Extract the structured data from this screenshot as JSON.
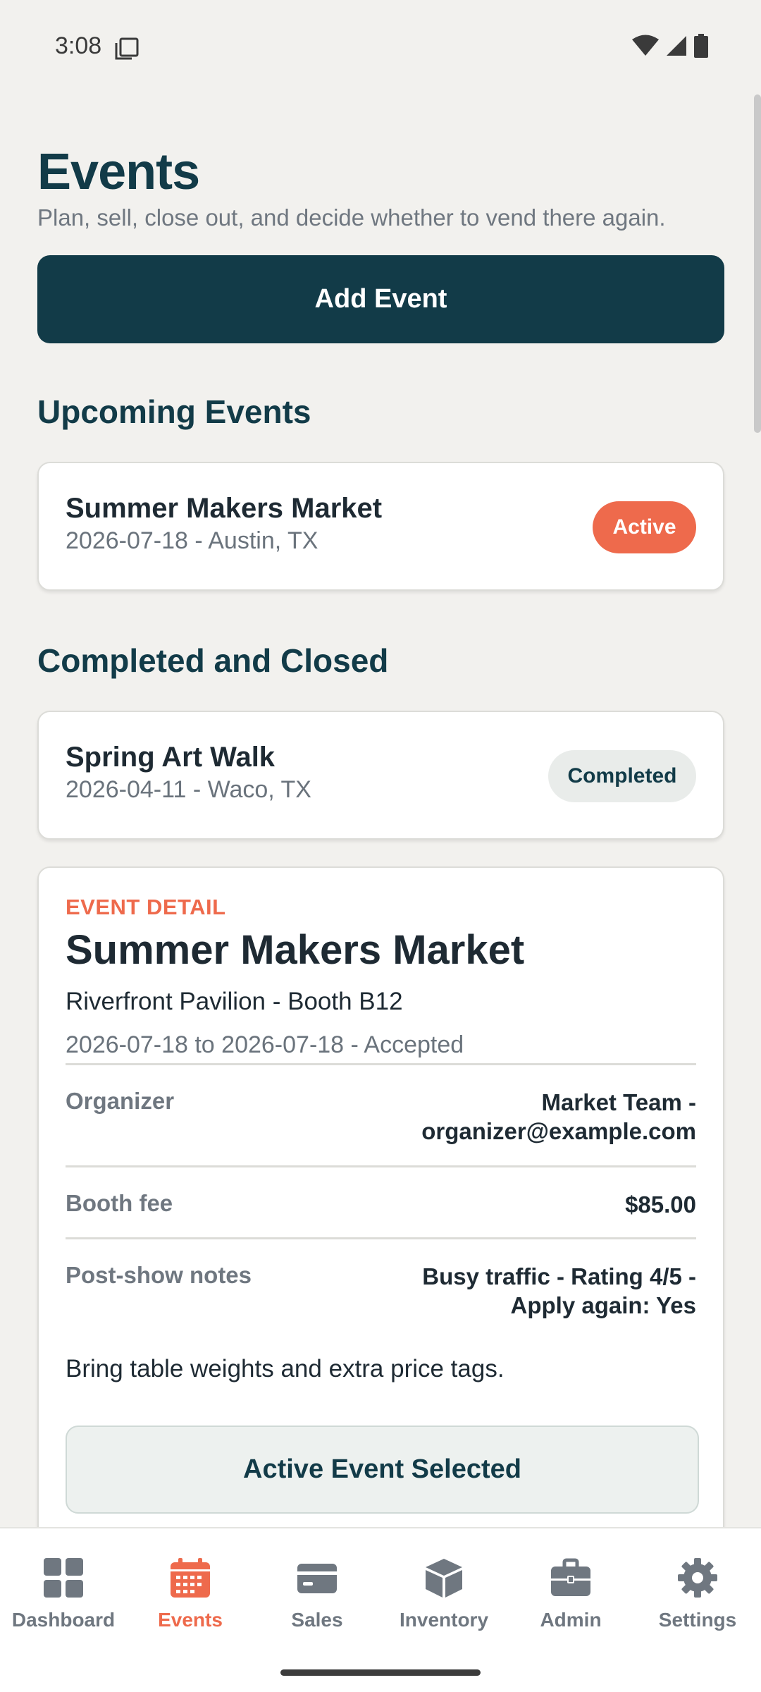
{
  "status_bar": {
    "time": "3:08"
  },
  "header": {
    "title": "Events",
    "subtitle": "Plan, sell, close out, and decide whether to vend there again."
  },
  "add_event_label": "Add Event",
  "upcoming": {
    "heading": "Upcoming Events",
    "events": [
      {
        "name": "Summer Makers Market",
        "meta": "2026-07-18 - Austin, TX",
        "status": "Active"
      }
    ]
  },
  "completed": {
    "heading": "Completed and Closed",
    "events": [
      {
        "name": "Spring Art Walk",
        "meta": "2026-04-11 - Waco, TX",
        "status": "Completed"
      }
    ]
  },
  "detail": {
    "eyebrow": "EVENT DETAIL",
    "title": "Summer Makers Market",
    "venue": "Riverfront Pavilion - Booth B12",
    "dates": "2026-07-18 to 2026-07-18 - Accepted",
    "organizer_label": "Organizer",
    "organizer_line1": "Market Team -",
    "organizer_line2": "organizer@example.com",
    "fee_label": "Booth fee",
    "fee_value": "$85.00",
    "notes_label": "Post-show notes",
    "notes_line1": "Busy traffic - Rating 4/5 -",
    "notes_line2": "Apply again: Yes",
    "note": "Bring table weights and extra price tags.",
    "selected_label": "Active Event Selected"
  },
  "nav": {
    "items": [
      {
        "label": "Dashboard",
        "icon": "dashboard-icon"
      },
      {
        "label": "Events",
        "icon": "calendar-icon"
      },
      {
        "label": "Sales",
        "icon": "card-icon"
      },
      {
        "label": "Inventory",
        "icon": "box-icon"
      },
      {
        "label": "Admin",
        "icon": "briefcase-icon"
      },
      {
        "label": "Settings",
        "icon": "gear-icon"
      }
    ],
    "active": "Events"
  },
  "colors": {
    "primary": "#123b48",
    "accent": "#ee6a4c",
    "background": "#f2f1ee",
    "muted": "#6f7780"
  }
}
